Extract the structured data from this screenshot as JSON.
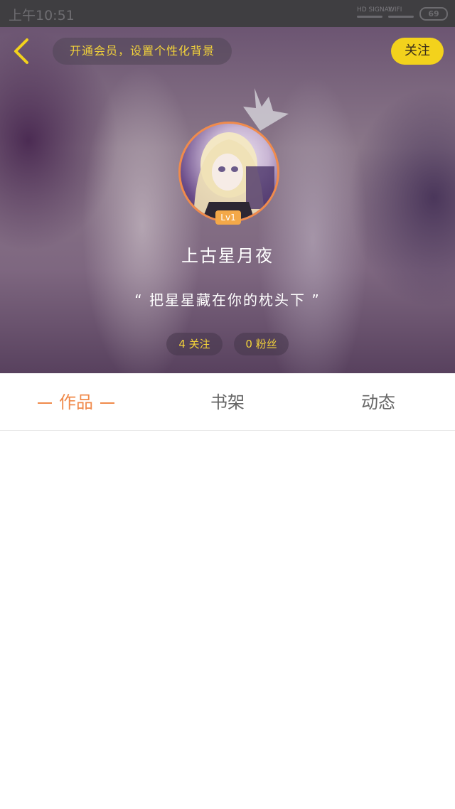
{
  "status_bar": {
    "time": "上午10:51",
    "signal_label": "HD SIGNAL",
    "wifi_label": "WIFI",
    "battery": "69"
  },
  "header": {
    "vip_prompt": "开通会员，设置个性化背景",
    "follow_label": "关注",
    "level": "Lv1",
    "username": "上古星月夜",
    "signature": "“ 把星星藏在你的枕头下 ”",
    "following": "4 关注",
    "fans": "0 粉丝",
    "colors": {
      "accent_yellow": "#f3d21c",
      "accent_orange": "#f08a4b"
    }
  },
  "tabs": [
    {
      "label": "作品",
      "active": true
    },
    {
      "label": "书架",
      "active": false
    },
    {
      "label": "动态",
      "active": false
    }
  ],
  "icons": {
    "back": "chevron-left-icon",
    "crown": "crown-icon"
  }
}
